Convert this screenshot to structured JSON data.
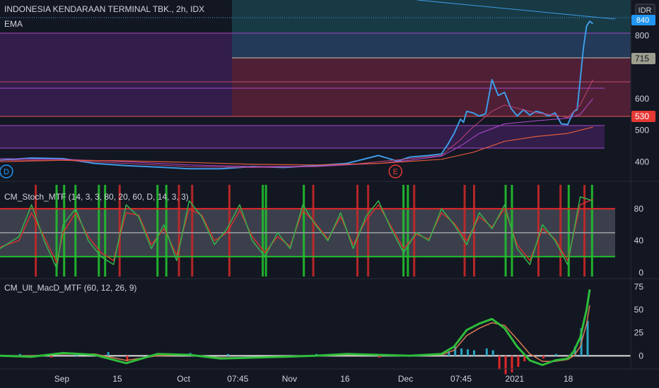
{
  "header": {
    "symbol_line": "INDONESIA KENDARAAN TERMINAL TBK., 2h, IDX",
    "indicator": "EMA",
    "currency": "IDR"
  },
  "colors": {
    "background": "#131722",
    "grid": "#1e2230",
    "text": "#d1d4dc",
    "price_line": "#3d9be6",
    "ema_fast": "#c2437a",
    "ema_mid": "#b44ad1",
    "ema_slow": "#e05a3a",
    "stoch_k": "#36b34a",
    "stoch_d": "#d63030",
    "macd_up": "#2ebd3a",
    "macd_down": "#e02828",
    "hist": "#2aa3c2",
    "last_price_tag": "#2196f3",
    "tag_715": "#9e9e8e",
    "tag_530": "#e53935"
  },
  "axis": {
    "time_labels": [
      {
        "label": "Sep",
        "x": 0.098
      },
      {
        "label": "15",
        "x": 0.186
      },
      {
        "label": "Oct",
        "x": 0.291
      },
      {
        "label": "07:45",
        "x": 0.377
      },
      {
        "label": "Nov",
        "x": 0.459
      },
      {
        "label": "16",
        "x": 0.547
      },
      {
        "label": "Dec",
        "x": 0.643
      },
      {
        "label": "07:45",
        "x": 0.731
      },
      {
        "label": "2021",
        "x": 0.816
      },
      {
        "label": "18",
        "x": 0.901
      }
    ]
  },
  "markers": [
    {
      "label": "D",
      "x": 0.01
    },
    {
      "label": "E",
      "x": 0.627
    }
  ],
  "price_tags": {
    "last": "840",
    "level_715": "715",
    "level_530": "530"
  },
  "chart_data": [
    {
      "type": "line",
      "name": "price",
      "ylim": [
        365,
        850
      ],
      "y_ticks": [
        400,
        500,
        600,
        700,
        800
      ],
      "y_tick_labels": [
        "400",
        "500",
        "600",
        "",
        "800"
      ],
      "series": [
        {
          "x": [
            0,
            0.05,
            0.1,
            0.15,
            0.2,
            0.25,
            0.3,
            0.35,
            0.4,
            0.45,
            0.5,
            0.55,
            0.58,
            0.6,
            0.63,
            0.65,
            0.68,
            0.7,
            0.71,
            0.72,
            0.73,
            0.735,
            0.74,
            0.75,
            0.76,
            0.77,
            0.78,
            0.79,
            0.8,
            0.81,
            0.82,
            0.83,
            0.84,
            0.85,
            0.86,
            0.87,
            0.88,
            0.89,
            0.9,
            0.905,
            0.91,
            0.915,
            0.92,
            0.925,
            0.93,
            0.935,
            0.94
          ],
          "y": [
            405,
            412,
            410,
            395,
            388,
            383,
            378,
            378,
            385,
            382,
            388,
            395,
            410,
            420,
            402,
            415,
            420,
            425,
            455,
            490,
            535,
            525,
            560,
            555,
            545,
            552,
            660,
            610,
            620,
            570,
            545,
            565,
            548,
            560,
            555,
            545,
            555,
            520,
            518,
            540,
            560,
            565,
            660,
            760,
            830,
            845,
            838
          ]
        },
        {
          "x": [
            0,
            0.1,
            0.2,
            0.3,
            0.4,
            0.5,
            0.55,
            0.6,
            0.65,
            0.7,
            0.73,
            0.75,
            0.78,
            0.8,
            0.82,
            0.85,
            0.88,
            0.9,
            0.92,
            0.94
          ],
          "y": [
            405,
            405,
            395,
            385,
            382,
            385,
            390,
            400,
            410,
            420,
            470,
            510,
            560,
            580,
            570,
            555,
            548,
            540,
            580,
            660
          ]
        },
        {
          "x": [
            0,
            0.1,
            0.2,
            0.3,
            0.4,
            0.5,
            0.6,
            0.65,
            0.7,
            0.73,
            0.76,
            0.8,
            0.85,
            0.9,
            0.92,
            0.94
          ],
          "y": [
            410,
            408,
            400,
            390,
            385,
            386,
            395,
            405,
            418,
            450,
            490,
            520,
            530,
            538,
            550,
            600
          ]
        },
        {
          "x": [
            0,
            0.1,
            0.2,
            0.3,
            0.4,
            0.5,
            0.6,
            0.7,
            0.75,
            0.8,
            0.85,
            0.9,
            0.94
          ],
          "y": [
            400,
            405,
            403,
            398,
            392,
            390,
            395,
            408,
            430,
            465,
            480,
            490,
            510
          ]
        }
      ]
    },
    {
      "type": "line",
      "name": "CM_Stoch_MTF (14, 3, 3, 80, 20, 60, D, 14, 3, 3)",
      "ylim": [
        -5,
        110
      ],
      "y_ticks": [
        0,
        40,
        80
      ],
      "levels": [
        20,
        50,
        80
      ],
      "series": [
        {
          "x": [
            0,
            0.03,
            0.05,
            0.07,
            0.09,
            0.1,
            0.12,
            0.14,
            0.16,
            0.18,
            0.2,
            0.22,
            0.24,
            0.26,
            0.28,
            0.3,
            0.32,
            0.34,
            0.36,
            0.38,
            0.4,
            0.42,
            0.44,
            0.46,
            0.48,
            0.5,
            0.52,
            0.54,
            0.56,
            0.58,
            0.6,
            0.62,
            0.64,
            0.66,
            0.68,
            0.7,
            0.72,
            0.74,
            0.76,
            0.78,
            0.8,
            0.82,
            0.84,
            0.86,
            0.88,
            0.9,
            0.92,
            0.94
          ],
          "y": [
            30,
            45,
            85,
            40,
            5,
            60,
            80,
            40,
            20,
            10,
            85,
            70,
            30,
            60,
            15,
            90,
            70,
            35,
            55,
            85,
            40,
            20,
            50,
            30,
            85,
            60,
            40,
            75,
            30,
            70,
            90,
            55,
            25,
            50,
            40,
            80,
            60,
            35,
            75,
            55,
            85,
            30,
            10,
            60,
            40,
            10,
            95,
            90
          ]
        },
        {
          "x": [
            0,
            0.03,
            0.05,
            0.07,
            0.09,
            0.1,
            0.12,
            0.14,
            0.16,
            0.18,
            0.2,
            0.22,
            0.24,
            0.26,
            0.28,
            0.3,
            0.32,
            0.34,
            0.36,
            0.38,
            0.4,
            0.42,
            0.44,
            0.46,
            0.48,
            0.5,
            0.52,
            0.54,
            0.56,
            0.58,
            0.6,
            0.62,
            0.64,
            0.66,
            0.68,
            0.7,
            0.72,
            0.74,
            0.76,
            0.78,
            0.8,
            0.82,
            0.84,
            0.86,
            0.88,
            0.9,
            0.92,
            0.94
          ],
          "y": [
            32,
            40,
            75,
            45,
            12,
            50,
            75,
            45,
            25,
            15,
            75,
            72,
            35,
            55,
            22,
            80,
            72,
            40,
            50,
            78,
            45,
            25,
            45,
            33,
            78,
            62,
            42,
            70,
            35,
            65,
            85,
            58,
            30,
            48,
            42,
            75,
            62,
            40,
            70,
            57,
            80,
            35,
            15,
            55,
            42,
            15,
            85,
            92
          ]
        }
      ]
    },
    {
      "type": "line",
      "name": "CM_Ult_MacD_MTF (60, 12, 26, 9)",
      "ylim": [
        -12,
        80
      ],
      "y_ticks": [
        0,
        25,
        50,
        75
      ],
      "series": [
        {
          "x": [
            0,
            0.05,
            0.1,
            0.15,
            0.2,
            0.25,
            0.3,
            0.35,
            0.4,
            0.45,
            0.5,
            0.55,
            0.6,
            0.65,
            0.7,
            0.72,
            0.74,
            0.76,
            0.78,
            0.8,
            0.82,
            0.84,
            0.86,
            0.88,
            0.9,
            0.91,
            0.92,
            0.93,
            0.935
          ],
          "y": [
            0,
            -1,
            3,
            1,
            -8,
            2,
            1,
            -3,
            -2,
            -1,
            0,
            2,
            1,
            0,
            2,
            10,
            28,
            35,
            40,
            30,
            10,
            -5,
            -10,
            -5,
            -3,
            5,
            20,
            50,
            72
          ]
        },
        {
          "x": [
            0,
            0.05,
            0.1,
            0.15,
            0.2,
            0.25,
            0.3,
            0.35,
            0.4,
            0.45,
            0.5,
            0.55,
            0.6,
            0.65,
            0.7,
            0.72,
            0.74,
            0.76,
            0.78,
            0.8,
            0.82,
            0.84,
            0.86,
            0.88,
            0.9,
            0.91,
            0.92,
            0.93,
            0.935
          ],
          "y": [
            0,
            0,
            2,
            2,
            -5,
            0,
            1,
            -2,
            -2,
            -1,
            0,
            1,
            1,
            0,
            1,
            6,
            22,
            30,
            36,
            33,
            18,
            2,
            -6,
            -6,
            -4,
            0,
            10,
            35,
            55
          ]
        }
      ],
      "histogram": {
        "x": [
          0.03,
          0.08,
          0.12,
          0.17,
          0.2,
          0.3,
          0.36,
          0.5,
          0.6,
          0.71,
          0.72,
          0.73,
          0.74,
          0.75,
          0.77,
          0.78,
          0.79,
          0.8,
          0.81,
          0.82,
          0.83,
          0.86,
          0.88,
          0.9,
          0.91,
          0.92,
          0.93
        ],
        "y": [
          2,
          -2,
          3,
          4,
          -6,
          3,
          2,
          2,
          -2,
          5,
          10,
          8,
          7,
          6,
          8,
          6,
          -15,
          -20,
          -18,
          -12,
          -6,
          -3,
          2,
          -4,
          10,
          30,
          38
        ]
      }
    }
  ]
}
